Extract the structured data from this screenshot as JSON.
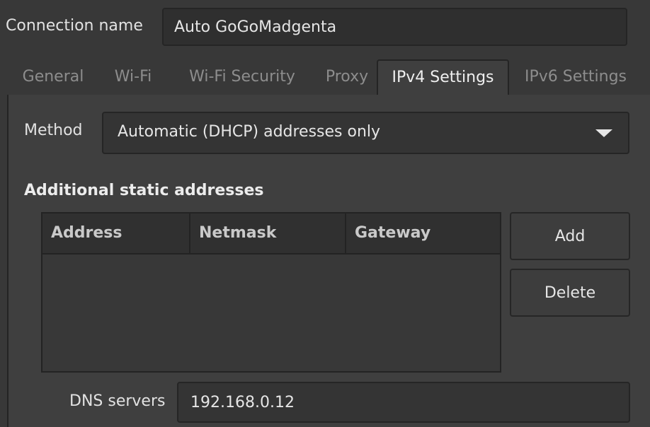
{
  "connection": {
    "label": "Connection name",
    "value": "Auto GoGoMadgenta"
  },
  "tabs": [
    {
      "label": "General",
      "active": false
    },
    {
      "label": "Wi-Fi",
      "active": false
    },
    {
      "label": "Wi-Fi Security",
      "active": false
    },
    {
      "label": "Proxy",
      "active": false
    },
    {
      "label": "IPv4 Settings",
      "active": true
    },
    {
      "label": "IPv6 Settings",
      "active": false
    }
  ],
  "method": {
    "label": "Method",
    "value": "Automatic (DHCP) addresses only"
  },
  "static_addresses": {
    "title": "Additional static addresses",
    "columns": [
      "Address",
      "Netmask",
      "Gateway"
    ],
    "rows": []
  },
  "buttons": {
    "add": "Add",
    "delete": "Delete"
  },
  "dns": {
    "label": "DNS servers",
    "value": "192.168.0.12"
  },
  "icons": {
    "combo_arrow": "chevron-down-icon"
  },
  "colors": {
    "background": "#383838",
    "panel": "#3f3f3f",
    "text": "#dedede",
    "inactive_tab_text": "#8d8d8d"
  }
}
